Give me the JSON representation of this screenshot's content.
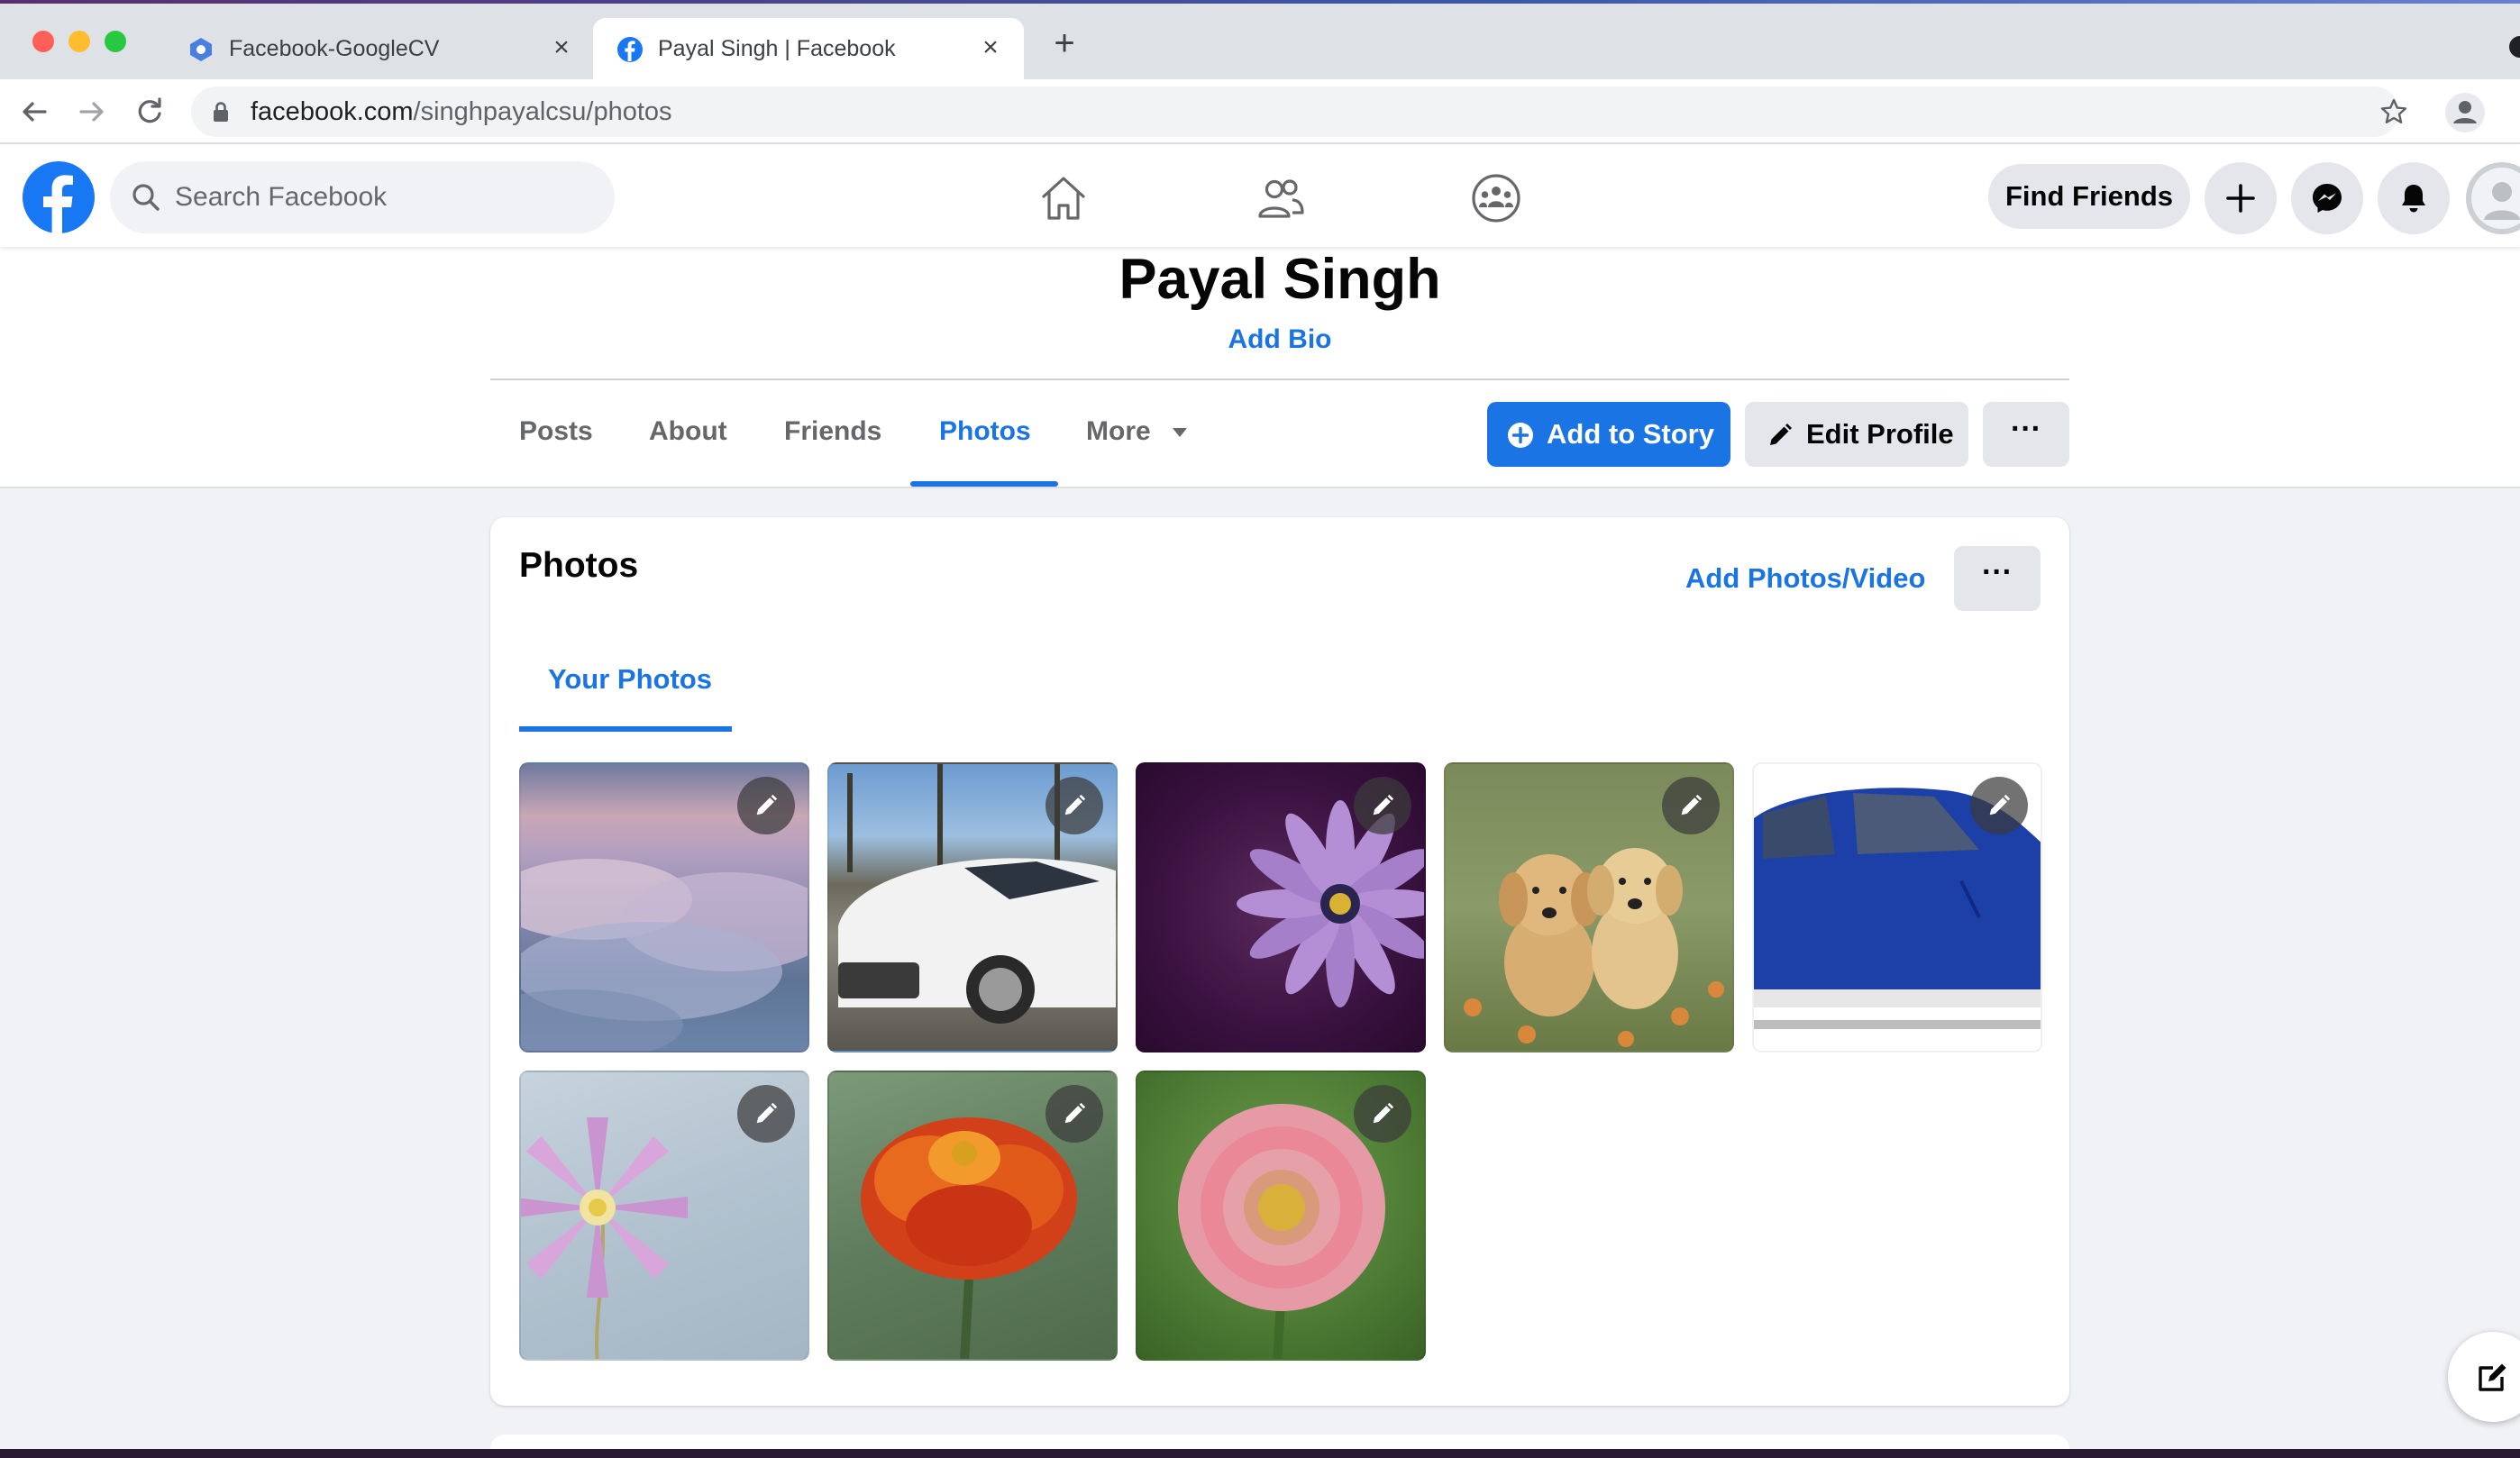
{
  "browser": {
    "tabs": [
      {
        "title": "Facebook-GoogleCV",
        "active": false
      },
      {
        "title": "Payal Singh | Facebook",
        "active": true
      }
    ],
    "url_host": "facebook.com",
    "url_path": "/singhpayalcsu/photos",
    "close_glyph": "×",
    "new_tab_glyph": "+"
  },
  "header": {
    "search_placeholder": "Search Facebook",
    "find_friends_label": "Find Friends",
    "icons": [
      "home-icon",
      "friends-icon",
      "groups-icon",
      "plus-icon",
      "messenger-icon",
      "notifications-icon"
    ]
  },
  "profile": {
    "name": "Payal Singh",
    "add_bio_label": "Add Bio",
    "tabs": [
      "Posts",
      "About",
      "Friends",
      "Photos",
      "More"
    ],
    "active_tab": "Photos",
    "add_to_story_label": "Add to Story",
    "edit_profile_label": "Edit Profile",
    "more_dots": "···"
  },
  "photos_section": {
    "title": "Photos",
    "add_photos_label": "Add Photos/Video",
    "more_dots": "···",
    "subtab": "Your Photos",
    "photos": [
      {
        "subject": "clouds"
      },
      {
        "subject": "white car"
      },
      {
        "subject": "purple daisy"
      },
      {
        "subject": "puppies"
      },
      {
        "subject": "blue car"
      },
      {
        "subject": "pink clematis"
      },
      {
        "subject": "orange marigold"
      },
      {
        "subject": "pink dahlia"
      }
    ]
  },
  "colors": {
    "fb_blue": "#1b74e4",
    "page_bg": "#f0f2f5",
    "button_gray": "#e4e6eb"
  }
}
